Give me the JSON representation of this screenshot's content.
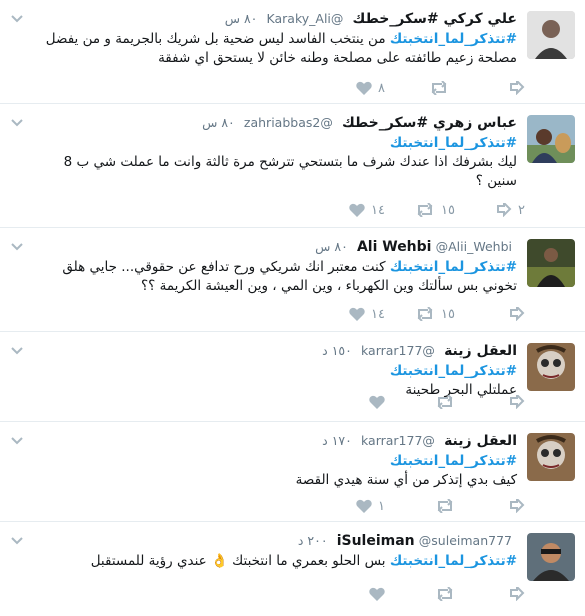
{
  "colors": {
    "hashtag": "#1b95e0",
    "icon": "#aab8c2",
    "meta": "#657786",
    "divider": "#e6ecf0"
  },
  "icons": {
    "reply": "reply-icon",
    "retweet": "retweet-icon",
    "like": "heart-icon",
    "caret": "chevron-down-icon"
  },
  "tweets": [
    {
      "name": "علي كركي #سكر_خطك",
      "handle": "@Karaky_Ali",
      "time": "٨٠ س",
      "hashtag": "#تتذكر_لما_انتخبتك",
      "text1": " من ينتخب الفاسد ليس ضحية بل شريك بالجريمة و من يفضل",
      "text2": "مصلحة زعيم طائفته على مصلحة وطنه خائن لا يستحق اي شفقة",
      "retweets": "",
      "likes": "٨"
    },
    {
      "name": "عباس زهري #سكر_خطك",
      "handle": "@zahriabbas2",
      "time": "٨٠ س",
      "hashtag": "#تتذكر_لما_انتخبتك",
      "text1": "ليك بشرفك اذا عندك شرف ما بتستحي تترشح مرة ثالثة وانت ما عملت شي ب 8",
      "text2": "سنين ؟",
      "replies": "٢",
      "retweets": "١٥",
      "likes": "١٤"
    },
    {
      "name": "Ali Wehbi",
      "handle": "@Alii_Wehbi",
      "time": "٨٠ س",
      "hashtag": "#تتذكر_لما_انتخبتك",
      "text1": " كنت معتبر انك شريكي ورح تدافع عن حقوقي... جايي هلق",
      "text2": "تخوني بس سألتك وين الكهرباء ، وين المي ، وين العيشة الكريمة ؟؟",
      "retweets": "١٥",
      "likes": "١٤"
    },
    {
      "name": "العقل زينة",
      "handle": "@karrar177",
      "time": "١٥٠ د",
      "hashtag": "#تتذكر_لما_انتخبتك",
      "text1": "عملتلي البحر طحينة"
    },
    {
      "name": "العقل زينة",
      "handle": "@karrar177",
      "time": "١٧٠ د",
      "hashtag": "#تتذكر_لما_انتخبتك",
      "text1": "كيف بدي إتذكر من أي سنة هيدي القصة",
      "likes": "١"
    },
    {
      "name": "iSuleiman",
      "handle": "@suleiman777",
      "time": "٢٠٠ د",
      "hashtag": "#تتذكر_لما_انتخبتك",
      "text1": " بس الحلو بعمري ما انتخبتك ",
      "emoji": "👌",
      "text2": " عندي رؤية للمستقبل"
    }
  ]
}
